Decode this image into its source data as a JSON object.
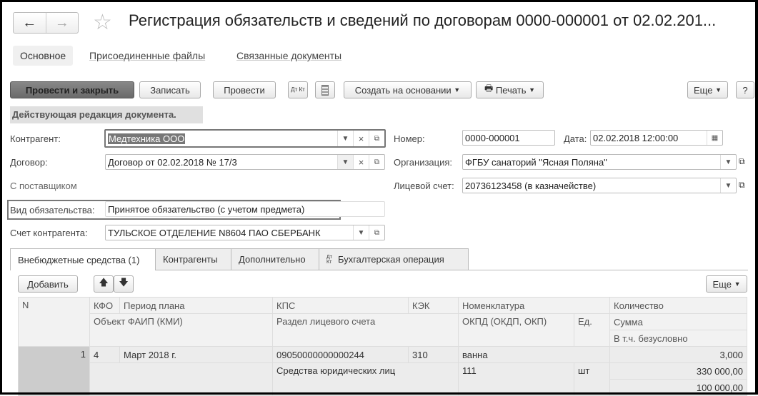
{
  "window": {
    "title": "Регистрация обязательств и сведений по договорам 0000-000001 от 02.02.201...",
    "back": "←",
    "forward": "→",
    "star": "☆"
  },
  "form_tabs": [
    "Основное",
    "Присоединенные файлы",
    "Связанные документы"
  ],
  "toolbar": {
    "post_close": "Провести и закрыть",
    "save": "Записать",
    "post": "Провести",
    "dtkt": "Дт Кт",
    "create_based": "Создать на основании",
    "print": "Печать",
    "more": "Еще",
    "help": "?"
  },
  "banner": "Действующая редакция документа.",
  "fields": {
    "counterparty_label": "Контрагент:",
    "counterparty": "Медтехника ООО",
    "contract_label": "Договор:",
    "contract": "Договор от 02.02.2018 № 17/3",
    "contract_type": "С поставщиком",
    "obligation_label": "Вид обязательства:",
    "obligation": "Принятое обязательство (с учетом предмета)",
    "account_label": "Счет контрагента:",
    "account": "ТУЛЬСКОЕ ОТДЕЛЕНИЕ N8604 ПАО СБЕРБАНК",
    "number_label": "Номер:",
    "number": "0000-000001",
    "date_label": "Дата:",
    "date": "02.02.2018 12:00:00",
    "org_label": "Организация:",
    "org": "ФГБУ санаторий \"Ясная Поляна\"",
    "personal_account_label": "Лицевой счет:",
    "personal_account": "20736123458 (в казначействе)"
  },
  "inner_tabs": [
    "Внебюджетные средства (1)",
    "Контрагенты",
    "Дополнительно",
    "Бухгалтерская операция"
  ],
  "table_toolbar": {
    "add": "Добавить",
    "more": "Еще"
  },
  "table": {
    "h1": [
      "N",
      "КФО",
      "Период плана",
      "КПС",
      "КЭК",
      "Номенклатура",
      "Количество"
    ],
    "h2": [
      "Объект ФАИП (КМИ)",
      "Раздел лицевого счета",
      "ОКПД (ОКДП, ОКП)",
      "Ед.",
      "Сумма"
    ],
    "h3": "В т.ч. безусловно",
    "row": {
      "n": "1",
      "kfo": "4",
      "period": "Март 2018 г.",
      "kps": "09050000000000244",
      "kek": "310",
      "nomenclature": "ванна",
      "quantity": "3,000",
      "section": "Средства юридических лиц",
      "okpd": "111",
      "unit": "шт",
      "sum": "330 000,00",
      "unconditional": "100 000,00"
    }
  }
}
